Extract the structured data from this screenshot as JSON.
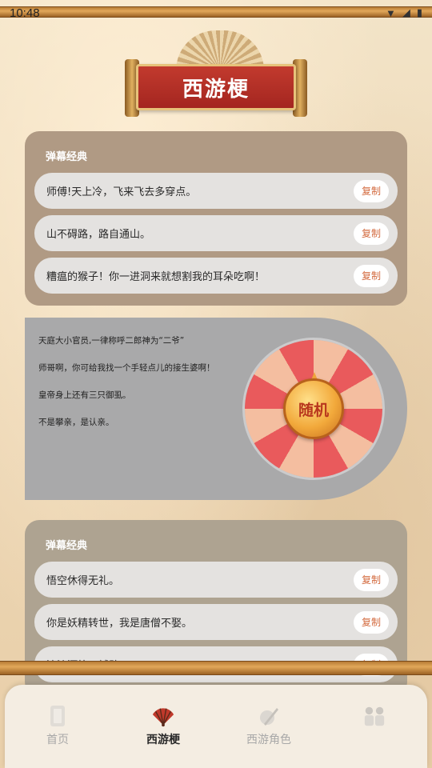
{
  "status": {
    "time": "10:48"
  },
  "banner": {
    "title": "西游梗"
  },
  "card_top": {
    "title": "弹幕经典",
    "copy_label": "复制",
    "rows": [
      {
        "text": "师傅!天上冷，飞来飞去多穿点。"
      },
      {
        "text": "山不碍路，路自通山。"
      },
      {
        "text": "糟瘟的猴子！你一进洞来就想割我的耳朵吃啊！"
      }
    ]
  },
  "wheel": {
    "button_label": "随机",
    "quotes": [
      "天庭大小官员,一律称呼二郎神为“二爷”",
      "师哥啊，你可给我找一个手轻点儿的接生婆啊！",
      "皇帝身上还有三只御虱。",
      "不是攀亲，是认亲。"
    ],
    "colors": {
      "red": "#e95a5c",
      "peach": "#f4bea0"
    }
  },
  "card_bottom": {
    "title": "弹幕经典",
    "copy_label": "复制",
    "rows": [
      {
        "text": "悟空休得无礼。"
      },
      {
        "text": "你是妖精转世，我是唐僧不娶。"
      },
      {
        "text": "流沙河第一辅助"
      }
    ]
  },
  "nav": {
    "items": [
      {
        "label": "首页",
        "icon": "home-icon"
      },
      {
        "label": "西游梗",
        "icon": "fan-icon"
      },
      {
        "label": "西游角色",
        "icon": "brush-icon"
      },
      {
        "label": "",
        "icon": "characters-icon"
      }
    ]
  }
}
